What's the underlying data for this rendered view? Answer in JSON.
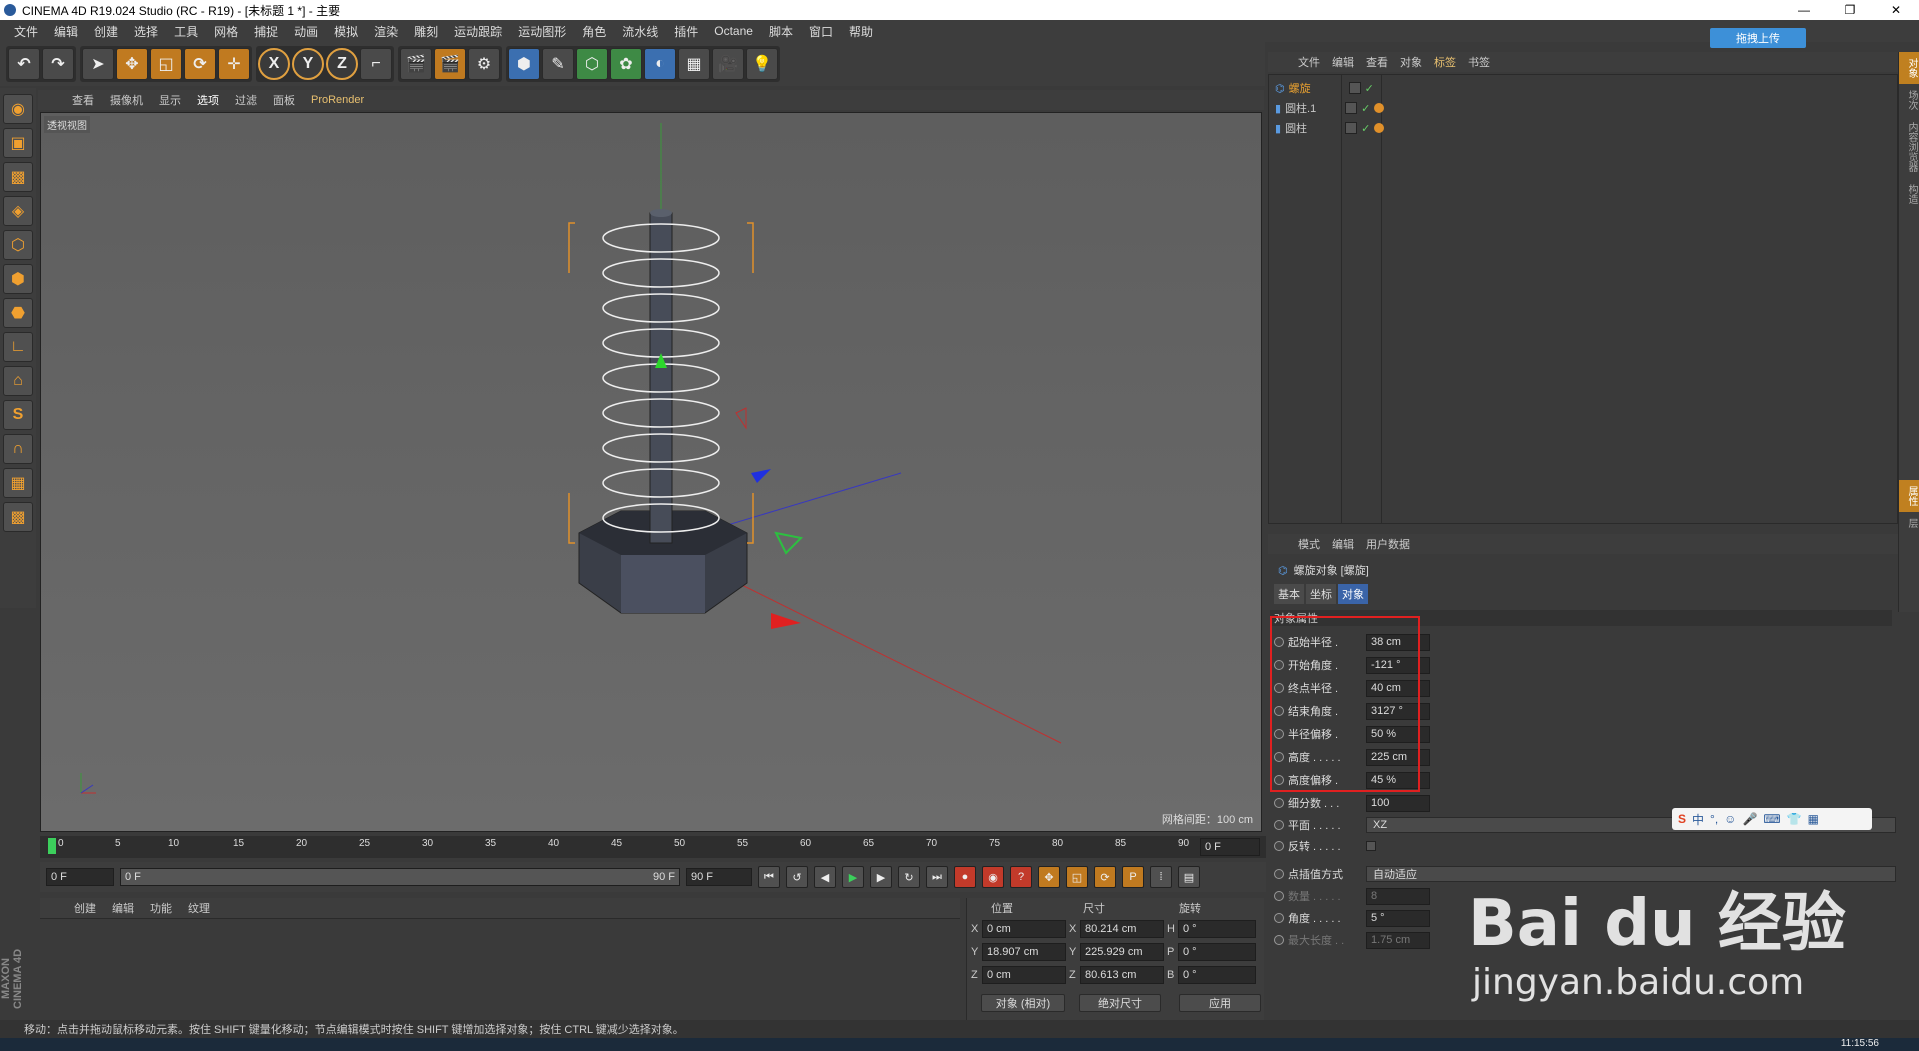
{
  "window": {
    "title": "CINEMA 4D R19.024 Studio (RC - R19) - [未标题 1 *] - 主要",
    "minimize": "—",
    "restore": "❐",
    "close": "✕"
  },
  "menu": [
    "文件",
    "编辑",
    "创建",
    "选择",
    "工具",
    "网格",
    "捕捉",
    "动画",
    "模拟",
    "渲染",
    "雕刻",
    "运动跟踪",
    "运动图形",
    "角色",
    "流水线",
    "插件",
    "Octane",
    "脚本",
    "窗口",
    "帮助"
  ],
  "upload_button": "拖拽上传",
  "toolbar": {
    "undo": "↶",
    "redo": "↷",
    "axis_x": "X",
    "axis_y": "Y",
    "axis_z": "Z"
  },
  "viewport": {
    "menu": [
      "查看",
      "摄像机",
      "显示",
      "选项",
      "过滤",
      "面板",
      "ProRender"
    ],
    "label": "透视视图",
    "grid_info": "网格间距：100 cm"
  },
  "timeline": {
    "ticks": [
      "0",
      "5",
      "10",
      "15",
      "20",
      "25",
      "30",
      "35",
      "40",
      "45",
      "50",
      "55",
      "60",
      "65",
      "70",
      "75",
      "80",
      "85",
      "90"
    ],
    "end_frame_field": "0 F",
    "start": "0 F",
    "slider_left": "0 F",
    "slider_right": "90 F",
    "end": "90 F"
  },
  "materials": {
    "menu": [
      "创建",
      "编辑",
      "功能",
      "纹理"
    ]
  },
  "coords": {
    "headers": [
      "位置",
      "尺寸",
      "旋转"
    ],
    "rows": [
      {
        "pos_label": "X",
        "pos": "0 cm",
        "size_label": "X",
        "size": "80.214 cm",
        "rot_label": "H",
        "rot": "0 °"
      },
      {
        "pos_label": "Y",
        "pos": "18.907 cm",
        "size_label": "Y",
        "size": "225.929 cm",
        "rot_label": "P",
        "rot": "0 °"
      },
      {
        "pos_label": "Z",
        "pos": "0 cm",
        "size_label": "Z",
        "size": "80.613 cm",
        "rot_label": "B",
        "rot": "0 °"
      }
    ],
    "mode": "对象 (相对)",
    "size_mode": "绝对尺寸",
    "apply": "应用"
  },
  "logo": "MAXON CINEMA 4D",
  "status": "移动：点击并拖动鼠标移动元素。按住 SHIFT 键量化移动；节点编辑模式时按住 SHIFT 键增加选择对象；按住 CTRL 键减少选择对象。",
  "clock": "11:15:56",
  "objects": {
    "menu": [
      "文件",
      "编辑",
      "查看",
      "对象",
      "标签",
      "书签"
    ],
    "active_menu": "标签",
    "items": [
      {
        "name": "螺旋",
        "selected": true,
        "tag": false
      },
      {
        "name": "圆柱.1",
        "selected": false,
        "tag": true
      },
      {
        "name": "圆柱",
        "selected": false,
        "tag": true
      }
    ]
  },
  "attributes": {
    "menu": [
      "模式",
      "编辑",
      "用户数据"
    ],
    "title": "螺旋对象 [螺旋]",
    "tabs": [
      "基本",
      "坐标",
      "对象"
    ],
    "active_tab": "对象",
    "section": "对象属性",
    "params": [
      {
        "label": "起始半径 .",
        "value": "38 cm"
      },
      {
        "label": "开始角度 .",
        "value": "-121 °"
      },
      {
        "label": "终点半径 .",
        "value": "40 cm"
      },
      {
        "label": "结束角度 .",
        "value": "3127 °"
      },
      {
        "label": "半径偏移 .",
        "value": "50 %"
      },
      {
        "label": "高度 . . . . .",
        "value": "225 cm"
      },
      {
        "label": "高度偏移 .",
        "value": "45 %"
      },
      {
        "label": "细分数 . . .",
        "value": "100"
      }
    ],
    "plane_label": "平面 . . . . .",
    "plane_value": "XZ",
    "reverse_label": "反转 . . . . .",
    "interp_label": "点插值方式",
    "interp_value": "自动适应",
    "count_label": "数量 . . . . .",
    "count_value": "8",
    "angle_label": "角度 . . . . .",
    "angle_value": "5 °",
    "maxlen_label": "最大长度 . .",
    "maxlen_value": "1.75 cm"
  },
  "right_tabs": [
    "对象",
    "场次",
    "内容浏览器",
    "构造"
  ],
  "right_tabs2": [
    "属性",
    "层"
  ],
  "watermark": {
    "brand": "Bai du 经验",
    "url": "jingyan.baidu.com"
  },
  "ime": {
    "logo": "S",
    "lang": "中"
  }
}
